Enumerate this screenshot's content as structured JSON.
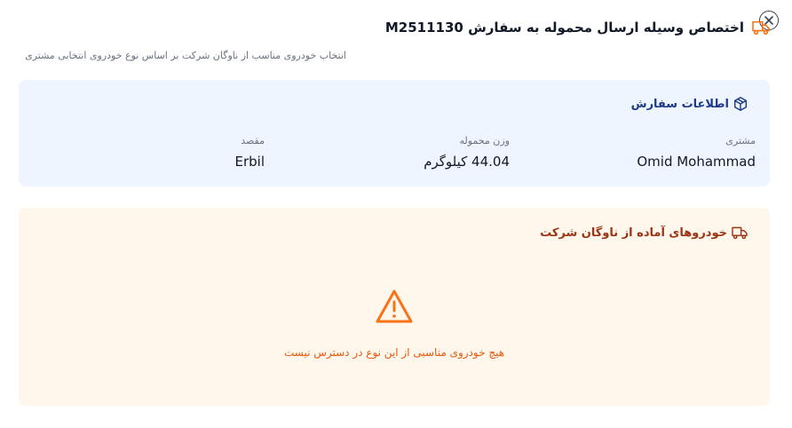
{
  "header": {
    "title": "اختصاص وسیله ارسال محموله به سفارش M2511130",
    "subtitle": "انتخاب خودروی مناسب از ناوگان شرکت بر اساس نوع خودروی انتخابی مشتری",
    "icon": "truck-icon"
  },
  "order_info": {
    "title": "اطلاعات سفارش",
    "icon": "package-icon",
    "customer_label": "مشتری",
    "customer_value": "Omid Mohammad",
    "weight_label": "وزن محموله",
    "weight_value": "44.04 کیلوگرم",
    "destination_label": "مقصد",
    "destination_value": "Erbil"
  },
  "vehicles": {
    "title": "خودروهای آماده از ناوگان شرکت",
    "icon": "truck-icon",
    "empty_icon": "warning-triangle-icon",
    "empty_message": "هیچ خودروی مناسبی از این نوع در دسترس نیست"
  },
  "colors": {
    "accent_orange": "#f97316",
    "info_bg": "#eef5ff",
    "warning_bg": "#fff6ec",
    "info_title": "#1e3a8a",
    "warning_title": "#9a3412"
  }
}
